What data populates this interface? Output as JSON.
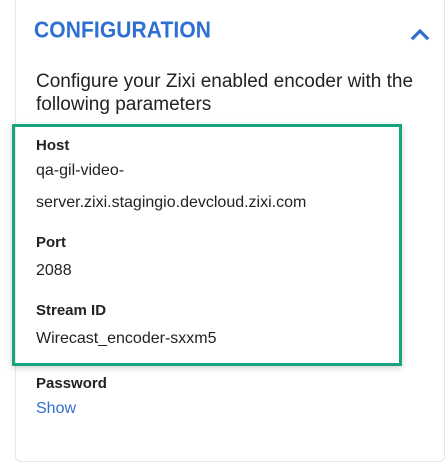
{
  "section": {
    "title": "CONFIGURATION",
    "collapse_icon": "chevron-up-icon",
    "description": "Configure your Zixi enabled encoder with the following parameters"
  },
  "fields": {
    "host": {
      "label": "Host",
      "value_line1": "qa-gil-video-",
      "value_line2": "server.zixi.stagingio.devcloud.zixi.com"
    },
    "port": {
      "label": "Port",
      "value": "2088"
    },
    "stream_id": {
      "label": "Stream ID",
      "value": "Wirecast_encoder-sxxm5"
    },
    "password": {
      "label": "Password",
      "show_link": "Show"
    }
  },
  "colors": {
    "accent": "#2f6fd1",
    "highlight": "#1aa37f",
    "text": "#222222"
  }
}
